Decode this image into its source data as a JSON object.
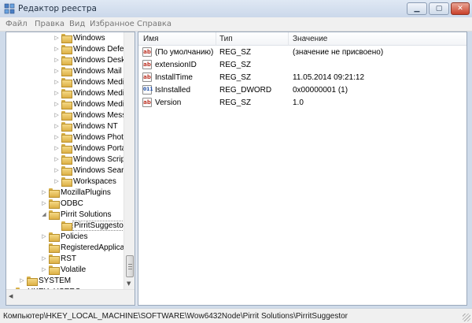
{
  "window": {
    "title": "Редактор реестра"
  },
  "menu": [
    "Файл",
    "Правка",
    "Вид",
    "Избранное",
    "Справка"
  ],
  "tree": [
    {
      "label": "Windows",
      "arrow": "▷",
      "indent": 3
    },
    {
      "label": "Windows Defender",
      "arrow": "▷",
      "indent": 3
    },
    {
      "label": "Windows Desktop Search",
      "arrow": "▷",
      "indent": 3
    },
    {
      "label": "Windows Mail",
      "arrow": "▷",
      "indent": 3
    },
    {
      "label": "Windows Media Device Manager",
      "arrow": "▷",
      "indent": 3
    },
    {
      "label": "Windows Media Foundation",
      "arrow": "▷",
      "indent": 3
    },
    {
      "label": "Windows Media Player NSS",
      "arrow": "▷",
      "indent": 3
    },
    {
      "label": "Windows Messaging Subsystem",
      "arrow": "▷",
      "indent": 3
    },
    {
      "label": "Windows NT",
      "arrow": "▷",
      "indent": 3
    },
    {
      "label": "Windows Photo Viewer",
      "arrow": "▷",
      "indent": 3
    },
    {
      "label": "Windows Portable Devices",
      "arrow": "▷",
      "indent": 3
    },
    {
      "label": "Windows Script Host",
      "arrow": "▷",
      "indent": 3
    },
    {
      "label": "Windows Search",
      "arrow": "▷",
      "indent": 3
    },
    {
      "label": "Workspaces",
      "arrow": "▷",
      "indent": 3
    },
    {
      "label": "MozillaPlugins",
      "arrow": "▷",
      "indent": 2
    },
    {
      "label": "ODBC",
      "arrow": "▷",
      "indent": 2
    },
    {
      "label": "Pirrit Solutions",
      "arrow": "◢",
      "indent": 2
    },
    {
      "label": "PirritSuggestor",
      "arrow": "",
      "indent": 3,
      "selected": true
    },
    {
      "label": "Policies",
      "arrow": "▷",
      "indent": 2
    },
    {
      "label": "RegisteredApplications",
      "arrow": "",
      "indent": 2
    },
    {
      "label": "RST",
      "arrow": "▷",
      "indent": 2
    },
    {
      "label": "Volatile",
      "arrow": "▷",
      "indent": 2
    },
    {
      "label": "SYSTEM",
      "arrow": "▷",
      "indent": 1
    },
    {
      "label": "HKEY_USERS",
      "arrow": "▷",
      "indent": 0
    }
  ],
  "list": {
    "headers": {
      "name": "Имя",
      "type": "Тип",
      "value": "Значение"
    },
    "rows": [
      {
        "icon": "string-value-icon",
        "name": "(По умолчанию)",
        "type": "REG_SZ",
        "value": "(значение не присвоено)"
      },
      {
        "icon": "string-value-icon",
        "name": "extensionID",
        "type": "REG_SZ",
        "value": ""
      },
      {
        "icon": "string-value-icon",
        "name": "InstallTime",
        "type": "REG_SZ",
        "value": "11.05.2014 09:21:12"
      },
      {
        "icon": "dword-value-icon",
        "name": "IsInstalled",
        "type": "REG_DWORD",
        "value": "0x00000001 (1)"
      },
      {
        "icon": "string-value-icon",
        "name": "Version",
        "type": "REG_SZ",
        "value": "1.0"
      }
    ]
  },
  "status": {
    "path": "Компьютер\\HKEY_LOCAL_MACHINE\\SOFTWARE\\Wow6432Node\\Pirrit Solutions\\PirritSuggestor"
  }
}
